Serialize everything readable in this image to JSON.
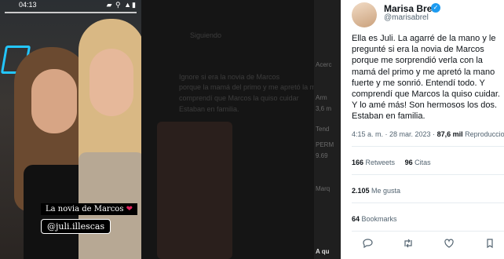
{
  "story": {
    "time": "04:13",
    "status_icons": "▰ ⚲ ▲▮",
    "caption": "La novia de Marcos",
    "heart": "❤",
    "mention": "@juli.illescas"
  },
  "middle": {
    "next_label": "»",
    "ghost_lines": [
      "Siguiendo",
      "Ignore si era la novia de Marcos",
      "porque la mamá del primo y me apretó la mano",
      "comprendí que Marcos la quiso cuidar",
      "Estaban en familia."
    ],
    "side_lines": [
      "Acerc",
      "Arm",
      "3,6 m",
      "Tend",
      "PERM",
      "9.69",
      "Marq",
      "A qu"
    ]
  },
  "tweet": {
    "name": "Marisa Brel",
    "verified_icon": "check",
    "handle": "@marisabrel",
    "text": "Ella es Juli. La agarré de la mano y le\npregunté si era la novia de Marcos\nporque me sorprendió verla con la\nmamá del primo y me apretó la mano\nfuerte y me sonrió. Entendí todo. Y\ncomprendí que Marcos la quiso cuidar.\nY lo amé más! Son hermosos los dos.\nEstaban en familia.",
    "timestamp": "4:15 a. m. · 28 mar. 2023 · ",
    "views_count": "87,6 mil",
    "views_label": " Reproducciones",
    "retweets_count": "166",
    "retweets_label": " Retweets",
    "quotes_count": "96",
    "quotes_label": " Citas",
    "likes_count": "2.105",
    "likes_label": " Me gusta",
    "bookmarks_count": "64",
    "bookmarks_label": " Bookmarks",
    "actions": [
      "reply-icon",
      "retweet-icon",
      "like-icon",
      "bookmark-icon"
    ]
  }
}
